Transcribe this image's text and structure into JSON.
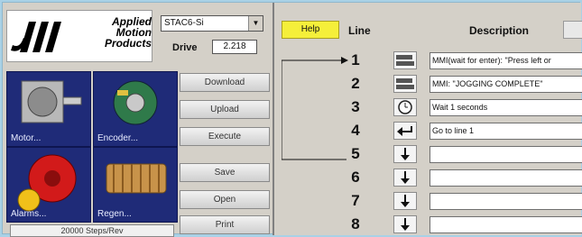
{
  "logo": {
    "line1": "Applied",
    "line2": "Motion",
    "line3": "Products"
  },
  "drive": {
    "model": "STAC6-Si",
    "label": "Drive",
    "version": "2.218"
  },
  "tiles": [
    {
      "label": "Motor..."
    },
    {
      "label": "Encoder..."
    },
    {
      "label": "Alarms..."
    },
    {
      "label": "Regen..."
    }
  ],
  "buttons": {
    "download": "Download",
    "upload": "Upload",
    "execute": "Execute",
    "save": "Save",
    "open": "Open",
    "print": "Print"
  },
  "steps_per_rev": "20000 Steps/Rev",
  "program": {
    "help": "Help",
    "col_line": "Line",
    "col_description": "Description",
    "rows": [
      {
        "num": "1",
        "icon": "mmi-icon",
        "text": "MMI(wait for enter): \"Press left or"
      },
      {
        "num": "2",
        "icon": "mmi-icon",
        "text": "MMI: \"JOGGING COMPLETE\""
      },
      {
        "num": "3",
        "icon": "clock-icon",
        "text": "Wait 1 seconds"
      },
      {
        "num": "4",
        "icon": "goto-icon",
        "text": "Go to line 1"
      },
      {
        "num": "5",
        "icon": "down-arrow-icon",
        "text": ""
      },
      {
        "num": "6",
        "icon": "down-arrow-icon",
        "text": ""
      },
      {
        "num": "7",
        "icon": "down-arrow-icon",
        "text": ""
      },
      {
        "num": "8",
        "icon": "down-arrow-icon",
        "text": ""
      }
    ]
  },
  "colors": {
    "help_yellow": "#f5ef3a",
    "tile_blue": "#1f2b78",
    "background": "#a9d1e6"
  }
}
